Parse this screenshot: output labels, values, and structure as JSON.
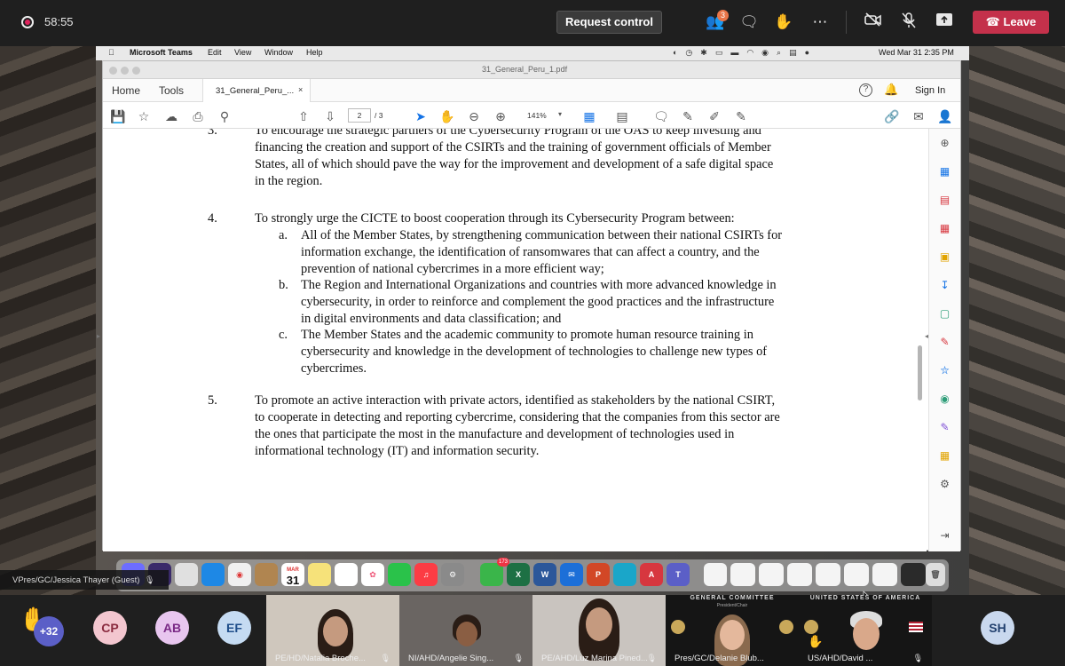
{
  "teams": {
    "timer": "58:55",
    "request_control": "Request control",
    "participants_badge": "3",
    "leave": "Leave"
  },
  "mac_menubar": {
    "app": "Microsoft Teams",
    "menus": [
      "Edit",
      "View",
      "Window",
      "Help"
    ],
    "datetime": "Wed Mar 31  2:35 PM"
  },
  "acrobat": {
    "window_title": "31_General_Peru_1.pdf",
    "nav": {
      "home": "Home",
      "tools": "Tools",
      "tab": "31_General_Peru_...",
      "tab_close": "×",
      "help": "?",
      "signin": "Sign In"
    },
    "page_current": "2",
    "page_total": "/ 3",
    "zoom": "141%"
  },
  "document": {
    "item3": {
      "num": "3.",
      "lines": [
        "To encourage the strategic partners of the Cybersecurity Program of the OAS to keep investing and",
        "financing the creation and support of the CSIRTs and the training of government officials of Member",
        "States, all of which should pave the way for the improvement and development of a safe digital space",
        "in the region."
      ]
    },
    "item4": {
      "num": "4.",
      "intro": "To strongly urge the CICTE to boost cooperation through its Cybersecurity Program between:",
      "subs": [
        {
          "letter": "a.",
          "lines": [
            "All of the Member States, by strengthening communication between their national CSIRTs for",
            "information exchange, the identification of ransomwares that can affect a country, and the",
            "prevention of national cybercrimes in a more efficient way;"
          ]
        },
        {
          "letter": "b.",
          "lines": [
            "The Region and International Organizations and countries with more advanced knowledge in",
            "cybersecurity, in order to reinforce and complement the good practices and the infrastructure",
            "in digital environments and data classification; and"
          ]
        },
        {
          "letter": "c.",
          "lines": [
            "The Member States and the academic community to promote human resource training in",
            "cybersecurity and knowledge in the development of technologies to challenge new types of",
            "cybercrimes."
          ]
        }
      ]
    },
    "item5": {
      "num": "5.",
      "lines": [
        "To promote an active interaction with private actors, identified as stakeholders by the national CSIRT,",
        "to cooperate in detecting and reporting cybercrime, considering that the companies from this sector are",
        "the ones that participate the most in the manufacture and development of technologies used in",
        "informational technology (IT) and information security."
      ]
    }
  },
  "dock": {
    "calendar_month": "MAR",
    "calendar_day": "31",
    "whatsapp_badge": "173"
  },
  "presenter": "VPres/GC/Jessica Thayer (Guest)",
  "participants": {
    "raised_hand": "✋",
    "more": "+32",
    "avatars": [
      "CP",
      "AB",
      "EF",
      "SH"
    ],
    "videos": [
      "PE/HD/Natalia Broche...",
      "NI/AHD/Angelie Sing...",
      "PE/AHD/Luz Marina Pined...",
      "Pres/GC/Delanie Blub...",
      "US/AHD/David ..."
    ],
    "video4_header": "GENERAL COMMITTEE",
    "video4_subheader": "President/Chair",
    "video5_header": "UNITED STATES OF AMERICA"
  }
}
